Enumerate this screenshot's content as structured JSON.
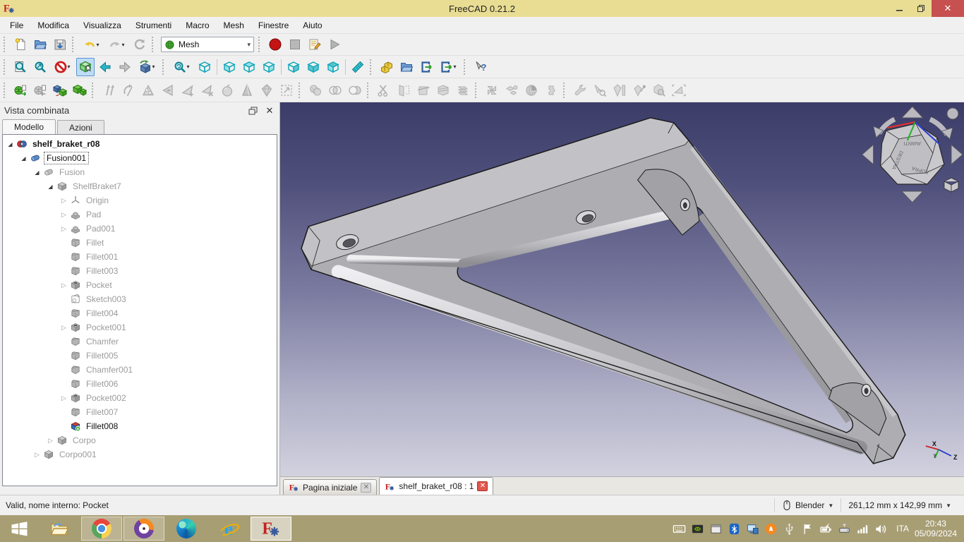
{
  "window": {
    "title": "FreeCAD 0.21.2"
  },
  "menu_bar": {
    "items": [
      "File",
      "Modifica",
      "Visualizza",
      "Strumenti",
      "Macro",
      "Mesh",
      "Finestre",
      "Aiuto"
    ]
  },
  "toolbars": {
    "file": [
      {
        "sep": true
      },
      {
        "name": "new-document",
        "icon": "new-doc"
      },
      {
        "name": "open-document",
        "icon": "open"
      },
      {
        "name": "save-document",
        "icon": "save"
      },
      {
        "sep": true
      },
      {
        "name": "undo",
        "icon": "undo",
        "dd": true
      },
      {
        "name": "redo",
        "icon": "redo",
        "dd": true
      },
      {
        "name": "refresh",
        "icon": "refresh"
      },
      {
        "sep": true
      },
      {
        "name": "workbench-selector",
        "combo": true,
        "icon": "sphere-green",
        "label": "Mesh"
      },
      {
        "sep": true
      },
      {
        "name": "macro-record",
        "icon": "record"
      },
      {
        "name": "macro-stop",
        "icon": "stop"
      },
      {
        "name": "macro-edit",
        "icon": "edit-macro"
      },
      {
        "name": "macro-run",
        "icon": "play"
      }
    ],
    "view": [
      {
        "sep": true
      },
      {
        "name": "fit-all",
        "icon": "fit-doc"
      },
      {
        "name": "fit-selection",
        "icon": "fit-sel"
      },
      {
        "name": "draw-style",
        "icon": "no-sign",
        "dd": true
      },
      {
        "name": "box-element-selection",
        "icon": "box-select",
        "active": true
      },
      {
        "name": "navigate-back",
        "icon": "nav-back"
      },
      {
        "name": "navigate-forward",
        "icon": "nav-fwd"
      },
      {
        "name": "isometric-view",
        "icon": "iso-view",
        "dd": true
      },
      {
        "sep": true
      },
      {
        "name": "zoom-tools",
        "icon": "zoom-region",
        "dd": true
      },
      {
        "name": "view-axonometric",
        "icon": "cube-axo"
      },
      {
        "vsep": true
      },
      {
        "name": "view-front",
        "icon": "cube-front"
      },
      {
        "name": "view-top",
        "icon": "cube-top"
      },
      {
        "name": "view-right",
        "icon": "cube-right"
      },
      {
        "vsep": true
      },
      {
        "name": "view-rear",
        "icon": "cube-rear"
      },
      {
        "name": "view-bottom",
        "icon": "cube-bottom"
      },
      {
        "name": "view-left",
        "icon": "cube-left"
      },
      {
        "vsep": true
      },
      {
        "name": "measure-distance",
        "icon": "ruler"
      },
      {
        "sep": true
      },
      {
        "name": "create-part",
        "icon": "part"
      },
      {
        "name": "create-group",
        "icon": "group"
      },
      {
        "name": "make-link",
        "icon": "link"
      },
      {
        "name": "make-sub-link",
        "icon": "link2",
        "dd": true
      },
      {
        "sep": true
      },
      {
        "name": "whats-this",
        "icon": "whatsthis"
      }
    ],
    "mesh": [
      {
        "sep": true
      },
      {
        "name": "import-mesh",
        "icon": "mesh-import"
      },
      {
        "name": "export-mesh",
        "icon": "mesh-export"
      },
      {
        "name": "mesh-from-shape",
        "icon": "shape2mesh"
      },
      {
        "name": "regular-solid",
        "icon": "meshes"
      },
      {
        "sep": true
      },
      {
        "name": "harmonize-normals",
        "icon": "g-arrows",
        "disabled": true
      },
      {
        "name": "flip-normals",
        "icon": "g-flip",
        "disabled": true
      },
      {
        "name": "fill-holes",
        "icon": "g-holetri",
        "disabled": true
      },
      {
        "name": "close-hole",
        "icon": "g-tri",
        "disabled": true
      },
      {
        "name": "add-triangle",
        "icon": "g-triplus",
        "disabled": true
      },
      {
        "name": "remove-components",
        "icon": "g-trix",
        "disabled": true
      },
      {
        "name": "smooth-mesh",
        "icon": "g-apple",
        "disabled": true
      },
      {
        "name": "refine-mesh",
        "icon": "g-cone",
        "disabled": true
      },
      {
        "name": "decimate-mesh",
        "icon": "g-diamond",
        "disabled": true
      },
      {
        "name": "bounding-box",
        "icon": "g-bbox",
        "disabled": true
      },
      {
        "sep": true
      },
      {
        "name": "union",
        "icon": "g-union",
        "disabled": true
      },
      {
        "name": "intersection",
        "icon": "g-intersect",
        "disabled": true
      },
      {
        "name": "difference",
        "icon": "g-diff",
        "disabled": true
      },
      {
        "sep": true
      },
      {
        "name": "trim-mesh",
        "icon": "g-scissors",
        "disabled": true
      },
      {
        "name": "trim-by-plane",
        "icon": "g-plane",
        "disabled": true
      },
      {
        "name": "create-section",
        "icon": "g-section",
        "disabled": true
      },
      {
        "name": "cross-sections",
        "icon": "g-cross",
        "disabled": true
      },
      {
        "name": "unwrap-mesh",
        "icon": "g-stack",
        "disabled": true
      },
      {
        "sep": true
      },
      {
        "name": "merge-meshes",
        "icon": "g-merge",
        "disabled": true
      },
      {
        "name": "split-components",
        "icon": "g-split",
        "disabled": true
      },
      {
        "name": "sphere-approximation",
        "icon": "g-globe",
        "disabled": true
      },
      {
        "name": "segmentation",
        "icon": "g-puzzle",
        "disabled": true
      },
      {
        "sep": true
      },
      {
        "name": "evaluate-repair",
        "icon": "g-wrench",
        "disabled": true
      },
      {
        "name": "check-solid",
        "icon": "g-checksel",
        "disabled": true
      },
      {
        "name": "curvature-plot",
        "icon": "g-curv",
        "disabled": true
      },
      {
        "name": "curvature-info",
        "icon": "g-curvpin",
        "disabled": true
      },
      {
        "name": "inspect-mesh",
        "icon": "g-inspect",
        "disabled": true
      },
      {
        "name": "boundary",
        "icon": "g-bound",
        "disabled": true
      }
    ]
  },
  "combined_view": {
    "title": "Vista combinata",
    "tabs": [
      {
        "label": "Modello",
        "active": true
      },
      {
        "label": "Azioni",
        "active": false
      }
    ]
  },
  "tree": {
    "items": [
      {
        "label": "shelf_braket_r08",
        "level": 0,
        "expand": "open",
        "icon": "tree-doc",
        "bold": true
      },
      {
        "label": "Fusion001",
        "level": 1,
        "expand": "open",
        "icon": "tree-fusion",
        "selected": true
      },
      {
        "label": "Fusion",
        "level": 2,
        "expand": "open",
        "icon": "tree-fusion-gray",
        "gray": true
      },
      {
        "label": "ShelfBraket7",
        "level": 3,
        "expand": "open",
        "icon": "tree-body",
        "gray": true
      },
      {
        "label": "Origin",
        "level": 4,
        "expand": "closed",
        "icon": "tree-origin",
        "gray": true
      },
      {
        "label": "Pad",
        "level": 4,
        "expand": "closed",
        "icon": "tree-pad",
        "gray": true
      },
      {
        "label": "Pad001",
        "level": 4,
        "expand": "closed",
        "icon": "tree-pad",
        "gray": true
      },
      {
        "label": "Fillet",
        "level": 4,
        "expand": "none",
        "icon": "tree-fillet",
        "gray": true
      },
      {
        "label": "Fillet001",
        "level": 4,
        "expand": "none",
        "icon": "tree-fillet",
        "gray": true
      },
      {
        "label": "Fillet003",
        "level": 4,
        "expand": "none",
        "icon": "tree-fillet",
        "gray": true
      },
      {
        "label": "Pocket",
        "level": 4,
        "expand": "closed",
        "icon": "tree-pocket",
        "gray": true
      },
      {
        "label": "Sketch003",
        "level": 4,
        "expand": "none",
        "icon": "tree-sketch",
        "gray": true
      },
      {
        "label": "Fillet004",
        "level": 4,
        "expand": "none",
        "icon": "tree-fillet",
        "gray": true
      },
      {
        "label": "Pocket001",
        "level": 4,
        "expand": "closed",
        "icon": "tree-pocket",
        "gray": true
      },
      {
        "label": "Chamfer",
        "level": 4,
        "expand": "none",
        "icon": "tree-chamfer",
        "gray": true
      },
      {
        "label": "Fillet005",
        "level": 4,
        "expand": "none",
        "icon": "tree-fillet",
        "gray": true
      },
      {
        "label": "Chamfer001",
        "level": 4,
        "expand": "none",
        "icon": "tree-chamfer",
        "gray": true
      },
      {
        "label": "Fillet006",
        "level": 4,
        "expand": "none",
        "icon": "tree-fillet",
        "gray": true
      },
      {
        "label": "Pocket002",
        "level": 4,
        "expand": "closed",
        "icon": "tree-pocket",
        "gray": true
      },
      {
        "label": "Fillet007",
        "level": 4,
        "expand": "none",
        "icon": "tree-fillet",
        "gray": true
      },
      {
        "label": "Fillet008",
        "level": 4,
        "expand": "none",
        "icon": "tree-fillet-tip",
        "gray": false
      },
      {
        "label": "Corpo",
        "level": 3,
        "expand": "closed",
        "icon": "tree-body",
        "gray": true
      },
      {
        "label": "Corpo001",
        "level": 2,
        "expand": "closed",
        "icon": "tree-body",
        "gray": true
      }
    ]
  },
  "mdi_tabs": {
    "tabs": [
      {
        "label": "Pagina iniziale",
        "close": "gray",
        "active": false
      },
      {
        "label": "shelf_braket_r08 : 1",
        "close": "red",
        "active": true
      }
    ]
  },
  "viewport": {
    "navigation_cube": {
      "front_label": "AVANTI",
      "right_label": "DESTRA",
      "top_label": "SOPRA"
    },
    "axes": {
      "x": "X",
      "y": "y",
      "z": "Z"
    }
  },
  "status_bar": {
    "message": "Valid, nome interno: Pocket",
    "navigation_style_label": "Blender",
    "view_dimensions": "261,12 mm x 142,99 mm"
  },
  "taskbar": {
    "apps": [
      {
        "name": "taskbar-app-explorer",
        "icon": "app-explorer"
      },
      {
        "name": "taskbar-app-chrome",
        "icon": "css-chrome",
        "running": true
      },
      {
        "name": "taskbar-app-avast-browser",
        "icon": "css-avast",
        "running": true
      },
      {
        "name": "taskbar-app-edge",
        "icon": "css-edge"
      },
      {
        "name": "taskbar-app-ie",
        "icon": "css-ie"
      },
      {
        "name": "taskbar-app-freecad",
        "icon": "app-freecad",
        "active": true
      }
    ],
    "tray": [
      {
        "name": "tray-keyboard-icon",
        "icon": "tr-kbd"
      },
      {
        "name": "tray-nvidia-icon",
        "icon": "tr-nvidia"
      },
      {
        "name": "tray-show-desktop-icon",
        "icon": "tr-window"
      },
      {
        "name": "tray-bluetooth-icon",
        "icon": "tr-bt"
      },
      {
        "name": "tray-network-pc-icon",
        "icon": "tr-net"
      },
      {
        "name": "tray-avast-icon",
        "icon": "tr-avast"
      },
      {
        "name": "tray-usb-icon",
        "icon": "tr-usb"
      },
      {
        "name": "tray-flag-icon",
        "icon": "tr-flag"
      },
      {
        "name": "tray-power-icon",
        "icon": "tr-batt"
      },
      {
        "name": "tray-remove-hardware-icon",
        "icon": "tr-drive"
      },
      {
        "name": "tray-signal-icon",
        "icon": "tr-signal"
      },
      {
        "name": "tray-volume-icon",
        "icon": "tr-vol"
      }
    ],
    "language": "ITA",
    "time": "20:43",
    "date": "05/09/2024"
  }
}
